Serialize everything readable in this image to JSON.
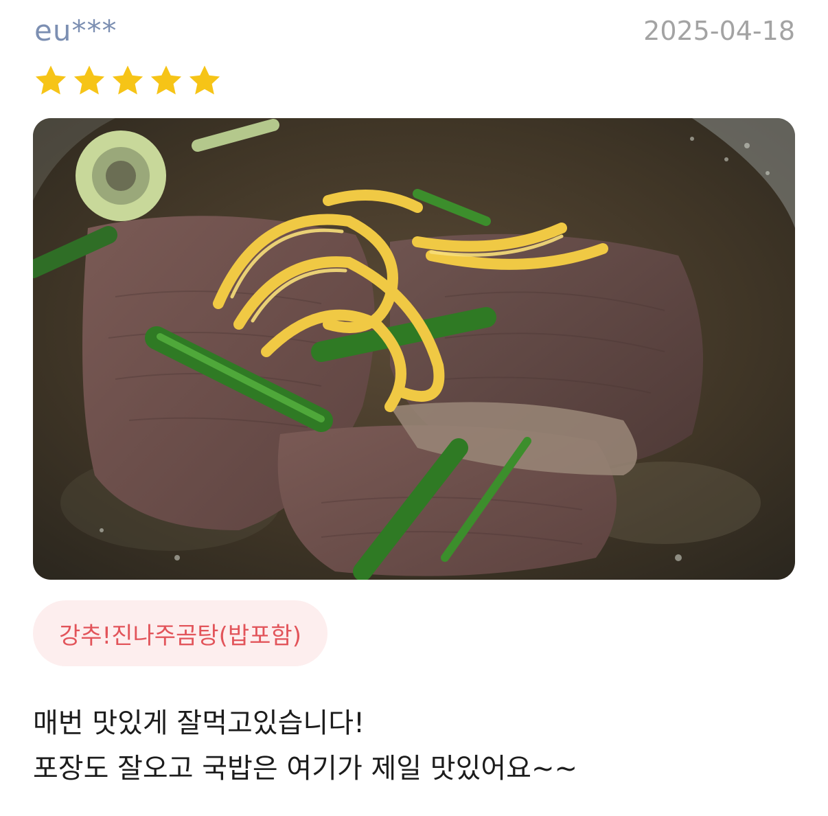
{
  "review": {
    "username": "eu***",
    "date": "2025-04-18",
    "rating": 5,
    "rating_max": 5,
    "photo_icon": "food-photo",
    "menu_item": "강추!진나주곰탕(밥포함)",
    "text_lines": [
      "매번 맛있게 잘먹고있습니다!",
      "포장도 잘오고 국밥은 여기가 제일 맛있어요~~"
    ]
  },
  "colors": {
    "username": "#7c8fb2",
    "date": "#a3a3a3",
    "star": "#f6c417",
    "chip_bg": "#fdeeee",
    "chip_text": "#e2545a"
  }
}
